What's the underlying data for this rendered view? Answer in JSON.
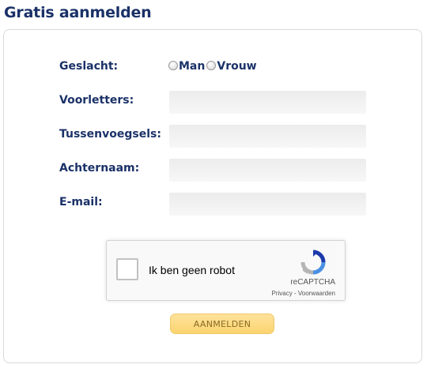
{
  "page": {
    "title": "Gratis aanmelden"
  },
  "form": {
    "gender": {
      "label": "Geslacht:",
      "options": [
        "Man",
        "Vrouw"
      ]
    },
    "fields": [
      {
        "label": "Voorletters:",
        "value": "",
        "placeholder": ""
      },
      {
        "label": "Tussenvoegsels:",
        "value": "",
        "placeholder": ""
      },
      {
        "label": "Achternaam:",
        "value": "",
        "placeholder": ""
      },
      {
        "label": "E-mail:",
        "value": "",
        "placeholder": ""
      }
    ],
    "submit_label": "AANMELDEN"
  },
  "captcha": {
    "text": "Ik ben geen robot",
    "brand": "reCAPTCHA",
    "privacy": "Privacy",
    "separator": " - ",
    "terms": "Voorwaarden",
    "icon": "recaptcha-logo-icon"
  },
  "colors": {
    "heading": "#1b3268",
    "button_bg": "#fbd46f",
    "button_text": "#8a6a23",
    "field_bg": "#efefef"
  }
}
